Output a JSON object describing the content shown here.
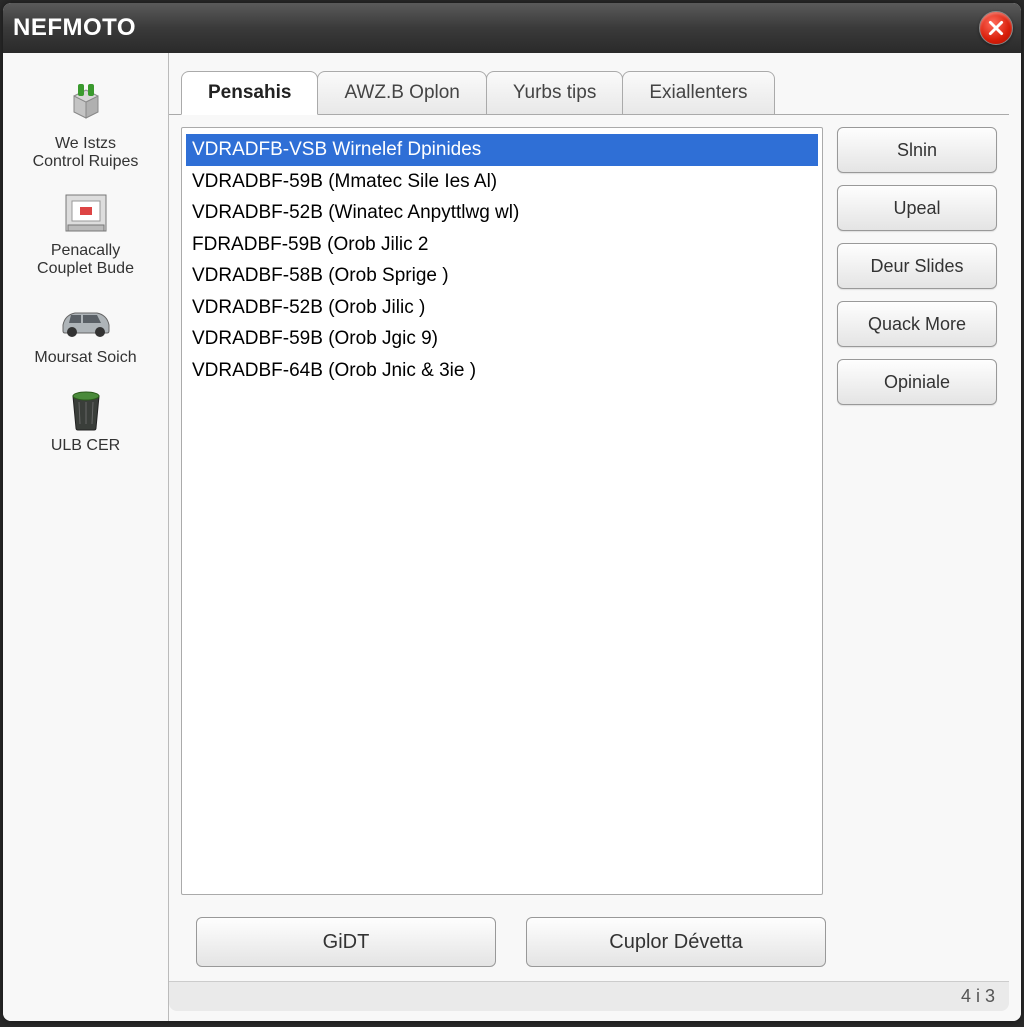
{
  "window": {
    "title": "NEFMOTO"
  },
  "sidebar": {
    "items": [
      {
        "label": "We Istzs\nControl Ruipes"
      },
      {
        "label": "Penacally\nCouplet Bude"
      },
      {
        "label": "Moursat Soich"
      },
      {
        "label": "ULB CER"
      }
    ]
  },
  "tabs": [
    {
      "label": "Pensahis",
      "active": true
    },
    {
      "label": "AWZ.B Oplon"
    },
    {
      "label": "Yurbs tips"
    },
    {
      "label": "Exiallenters"
    }
  ],
  "list": {
    "items": [
      {
        "text": "VDRADFB-VSB Wirnelef Dpinides",
        "selected": true
      },
      {
        "text": "VDRADBF-59B (Mmatec Sile Ies Al)"
      },
      {
        "text": "VDRADBF-52B (Winatec Anpyttlwg wl)"
      },
      {
        "text": "FDRADBF-59B (Orob Jilic 2"
      },
      {
        "text": "VDRADBF-58B (Orob Sprige )"
      },
      {
        "text": "VDRADBF-52B (Orob Jilic )"
      },
      {
        "text": "VDRADBF-59B (Orob Jgic 9)"
      },
      {
        "text": "VDRADBF-64B (Orob Jnic & 3ie )"
      }
    ]
  },
  "actions": {
    "buttons": [
      {
        "label": "Slnin"
      },
      {
        "label": "Upeal"
      },
      {
        "label": "Deur Slides"
      },
      {
        "label": "Quack More"
      },
      {
        "label": "Opiniale"
      }
    ]
  },
  "bottom": {
    "left": "GiDT",
    "right": "Cuplor Dévetta"
  },
  "status": {
    "text": "4 i 3"
  }
}
